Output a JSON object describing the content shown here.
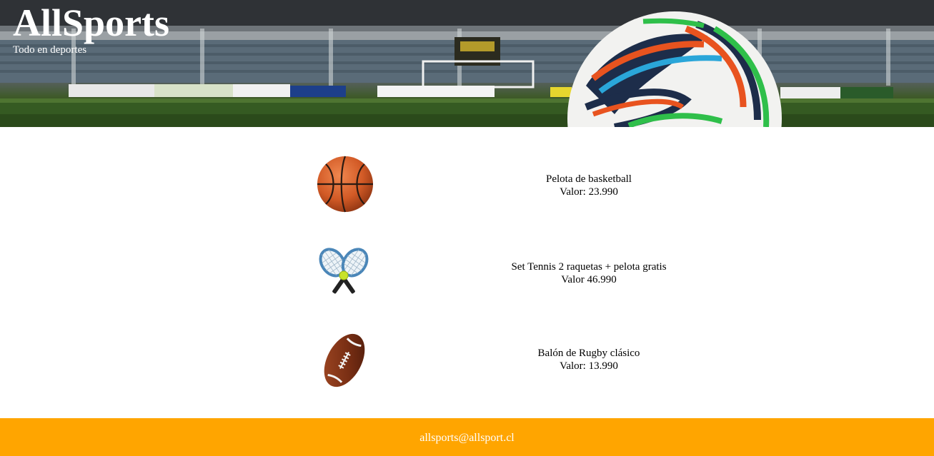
{
  "header": {
    "title": "AllSports",
    "tagline": "Todo en deportes",
    "banner_image": "stadium-soccer-ball-banner"
  },
  "products": [
    {
      "name": "Pelota de basketball",
      "price": "Valor: 23.990",
      "icon": "basketball-icon"
    },
    {
      "name": "Set Tennis 2 raquetas + pelota gratis",
      "price": "Valor 46.990",
      "icon": "tennis-rackets-icon"
    },
    {
      "name": "Balón de Rugby clásico",
      "price": "Valor: 13.990",
      "icon": "rugby-ball-icon"
    }
  ],
  "footer": {
    "email": "allsports@allsport.cl"
  },
  "colors": {
    "footer_background": "#ffa500",
    "header_text": "#ffffff",
    "page_background": "#ffffff"
  }
}
